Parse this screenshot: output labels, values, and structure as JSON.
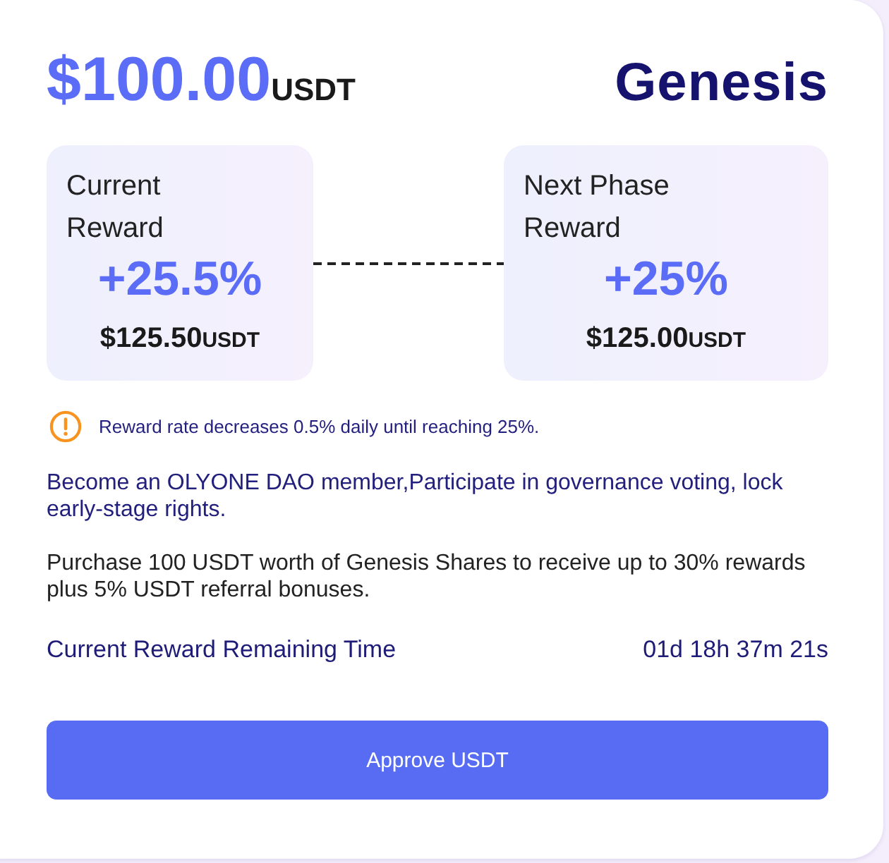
{
  "header": {
    "price": "$100.00",
    "price_unit": "USDT",
    "title": "Genesis"
  },
  "reward_cards": [
    {
      "label": "Current Reward",
      "percent": "+25.5%",
      "amount": "$125.50",
      "amount_unit": "USDT"
    },
    {
      "label": "Next Phase Reward",
      "percent": "+25%",
      "amount": "$125.00",
      "amount_unit": "USDT"
    }
  ],
  "notice": {
    "text": "Reward rate decreases 0.5% daily until reaching 25%."
  },
  "paragraphs": [
    {
      "kind": "highlight",
      "text": "Become an OLYONE DAO member,Participate in governance voting, lock early-stage rights."
    },
    {
      "kind": "plain",
      "text": "Purchase 100 USDT worth of Genesis Shares to receive up to 30% rewards plus 5% USDT referral bonuses."
    }
  ],
  "countdown": {
    "label": "Current Reward Remaining Time",
    "value": "01d 18h 37m 21s"
  },
  "button": {
    "label": "Approve USDT"
  }
}
